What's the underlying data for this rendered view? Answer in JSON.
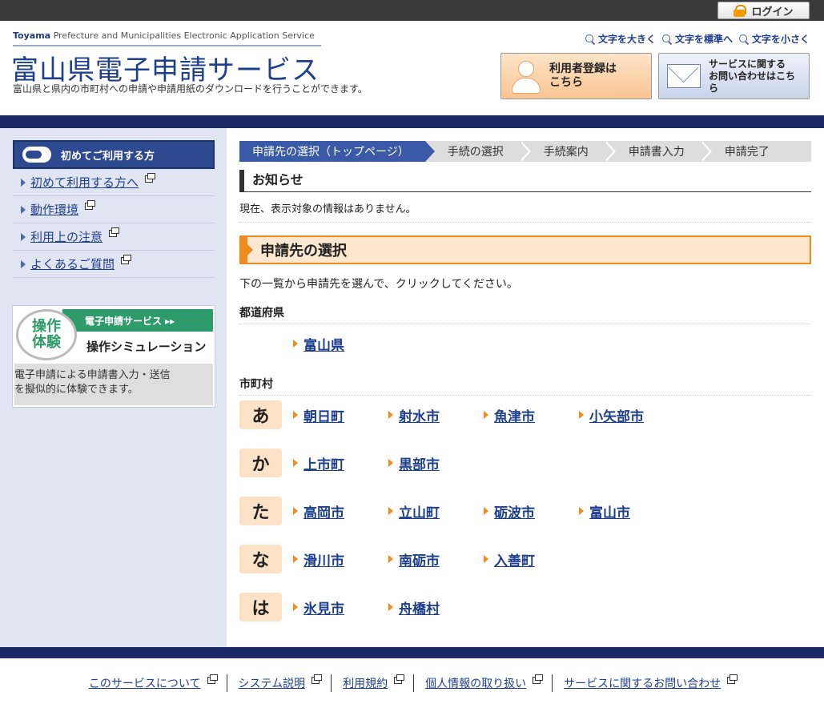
{
  "topbar": {
    "login_label": "ログイン"
  },
  "header": {
    "logo_en_bold": "Toyama",
    "logo_en_rest": " Prefecture and Municipalities Electronic Application Service",
    "logo_ja": "富山県電子申請サービス",
    "desc": "富山県と県内の市町村への申請や申請用紙のダウンロードを行うことができます。",
    "font_size": {
      "large": "文字を大きく",
      "standard": "文字を標準へ",
      "small": "文字を小さく"
    },
    "register_btn": {
      "line1": "利用者登録は",
      "line2": "こちら"
    },
    "contact_btn": {
      "line1": "サービスに関する",
      "line2": "お問い合わせはこちら"
    }
  },
  "sidebar": {
    "heading": "初めてご利用する方",
    "items": [
      {
        "label": "初めて利用する方へ"
      },
      {
        "label": "動作環境"
      },
      {
        "label": "利用上の注意"
      },
      {
        "label": "よくあるご質問"
      }
    ],
    "sim_banner": {
      "circle_line1": "操作",
      "circle_line2": "体験",
      "green_label": "電子申請サービス ▸▸",
      "sub_label": "操作シミュレーション",
      "desc_line1": "電子申請による申請書入力・送信",
      "desc_line2": "を擬似的に体験できます。"
    }
  },
  "steps": [
    {
      "label": "申請先の選択（トップページ）"
    },
    {
      "label": "手続の選択"
    },
    {
      "label": "手続案内"
    },
    {
      "label": "申請書入力"
    },
    {
      "label": "申請完了"
    }
  ],
  "notice": {
    "title": "お知らせ",
    "text": "現在、表示対象の情報はありません。"
  },
  "selection": {
    "title": "申請先の選択",
    "desc": "下の一覧から申請先を選んで、クリックしてください。",
    "prefecture_label": "都道府県",
    "prefecture": "富山県",
    "municipality_label": "市町村",
    "rows": [
      {
        "kana": "あ",
        "cities": [
          "朝日町",
          "射水市",
          "魚津市",
          "小矢部市"
        ]
      },
      {
        "kana": "か",
        "cities": [
          "上市町",
          "黒部市"
        ]
      },
      {
        "kana": "た",
        "cities": [
          "高岡市",
          "立山町",
          "砺波市",
          "富山市"
        ]
      },
      {
        "kana": "な",
        "cities": [
          "滑川市",
          "南砺市",
          "入善町"
        ]
      },
      {
        "kana": "は",
        "cities": [
          "氷見市",
          "舟橋村"
        ]
      }
    ]
  },
  "footer": {
    "links": [
      {
        "label": "このサービスについて"
      },
      {
        "label": "システム説明"
      },
      {
        "label": "利用規約"
      },
      {
        "label": "個人情報の取り扱い"
      },
      {
        "label": "サービスに関するお問い合わせ"
      }
    ]
  },
  "colors": {
    "navy": "#1b2a66",
    "brand_blue": "#1e3f8c",
    "accent_orange": "#f08c1e",
    "kana_bg": "#fde2c8",
    "sidebar_bg": "#e1e5f2"
  }
}
